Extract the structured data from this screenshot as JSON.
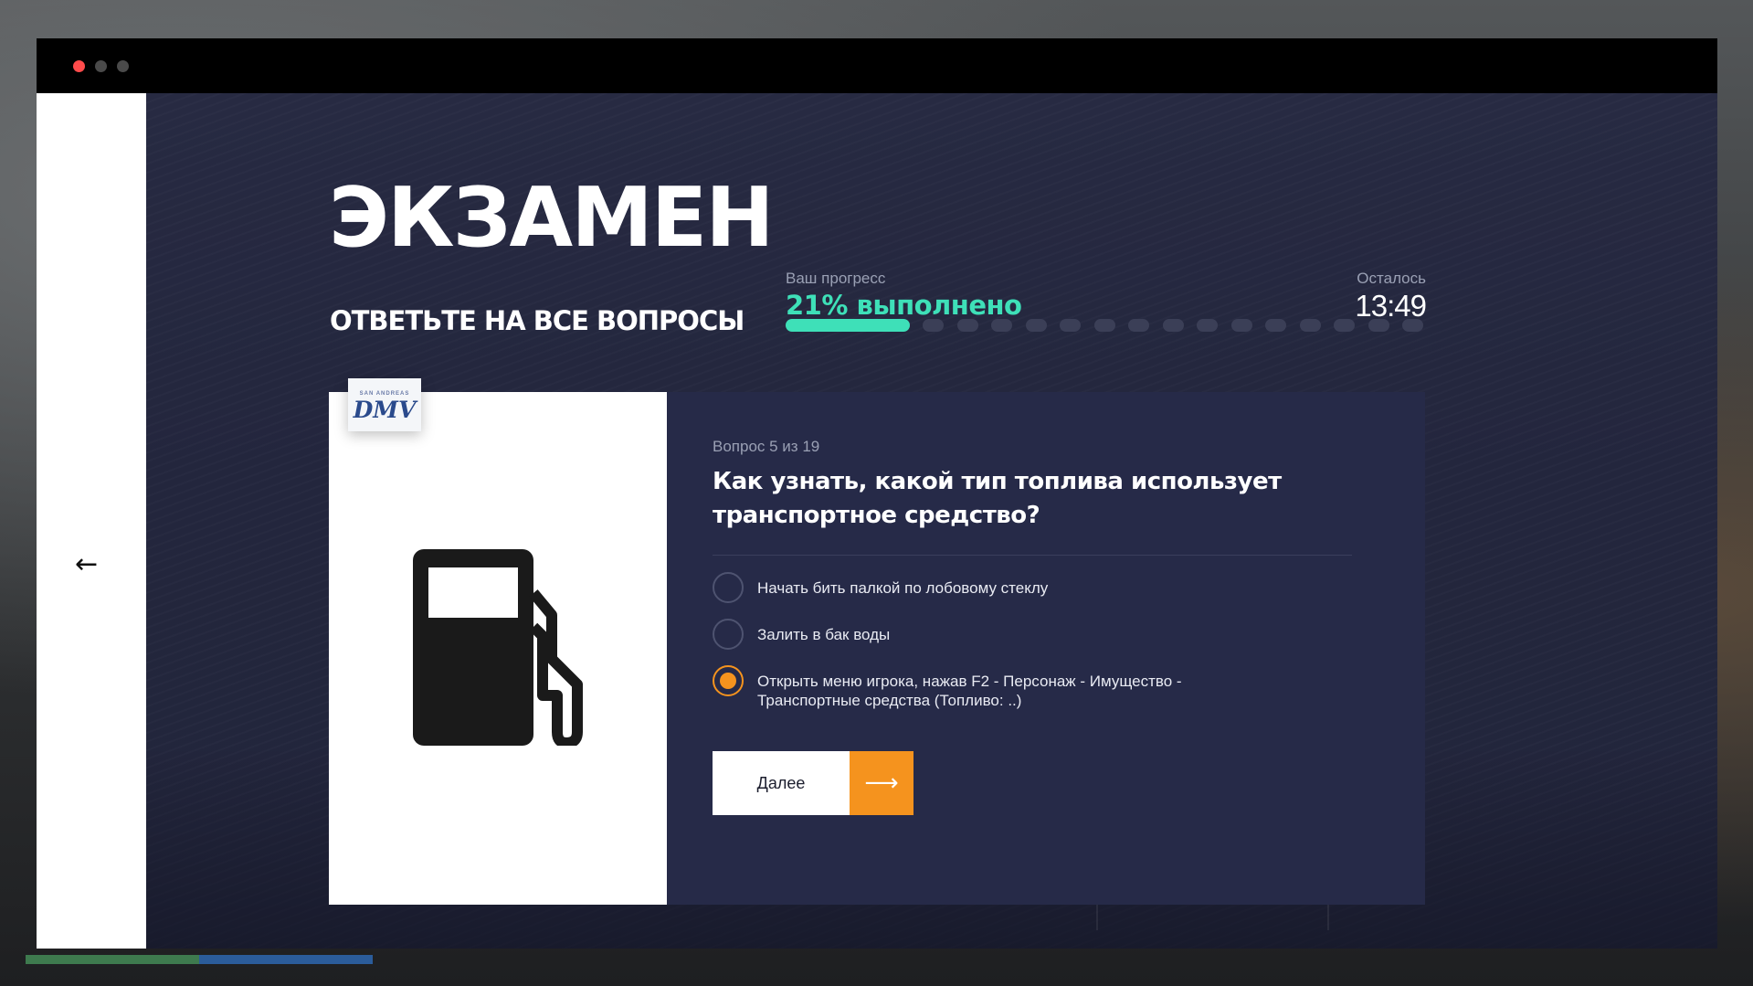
{
  "window": {
    "controls": [
      "close",
      "minimize",
      "maximize"
    ]
  },
  "sidebar": {
    "back_icon": "←"
  },
  "header": {
    "title": "ЭКЗАМЕН",
    "subtitle": "ОТВЕТЬТЕ НА ВСЕ ВОПРОСЫ",
    "progress_label": "Ваш прогресс",
    "progress_value": "21% выполнено",
    "time_label": "Осталось",
    "time_value": "13:49"
  },
  "progress": {
    "completed_fraction": 0.21,
    "total_steps": 19,
    "active_color": "#3ee0b8"
  },
  "question": {
    "badge": "DMV",
    "badge_small": "SAN ANDREAS",
    "image_icon": "fuel-pump-icon",
    "meta": "Вопрос 5 из 19",
    "text": "Как узнать, какой тип топлива использует транспортное средство?",
    "options": [
      {
        "label": "Начать бить палкой по лобовому стеклу",
        "selected": false
      },
      {
        "label": "Залить в бак воды",
        "selected": false
      },
      {
        "label": "Открыть меню игрока, нажав F2 - Персонаж - Имущество - Транспортные средства (Топливо: ..)",
        "selected": true
      }
    ],
    "next_label": "Далее",
    "next_icon": "⟶",
    "accent_color": "#f5931e"
  }
}
